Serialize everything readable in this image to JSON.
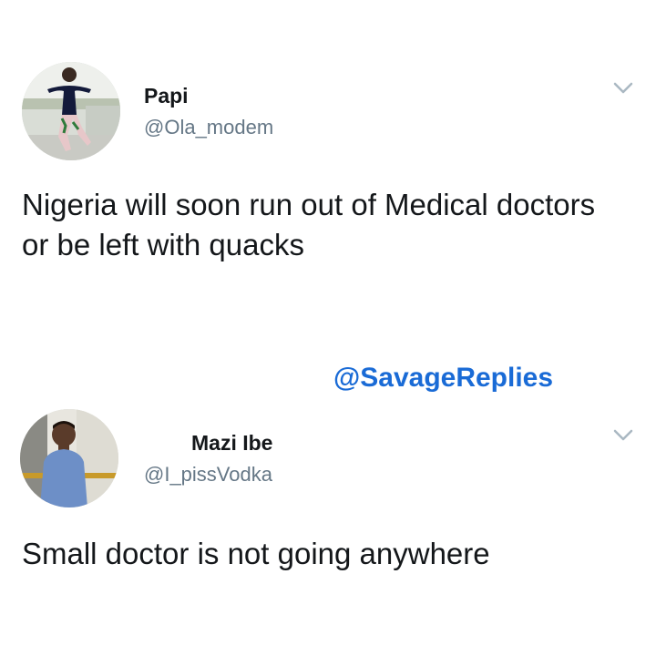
{
  "tweets": [
    {
      "display_name": "Papi",
      "handle": "@Ola_modem",
      "text": "Nigeria will soon run out of Medical doctors or be left with quacks",
      "menu_icon": "chevron-down-icon"
    },
    {
      "display_name": "Mazi Ibe",
      "handle": "@I_pissVodka",
      "text": "Small doctor is not going anywhere",
      "menu_icon": "chevron-down-icon"
    }
  ],
  "watermark": "@SavageReplies",
  "colors": {
    "name": "#14171a",
    "handle": "#657786",
    "watermark": "#1a6bd6",
    "chevron": "#aab8c2"
  }
}
